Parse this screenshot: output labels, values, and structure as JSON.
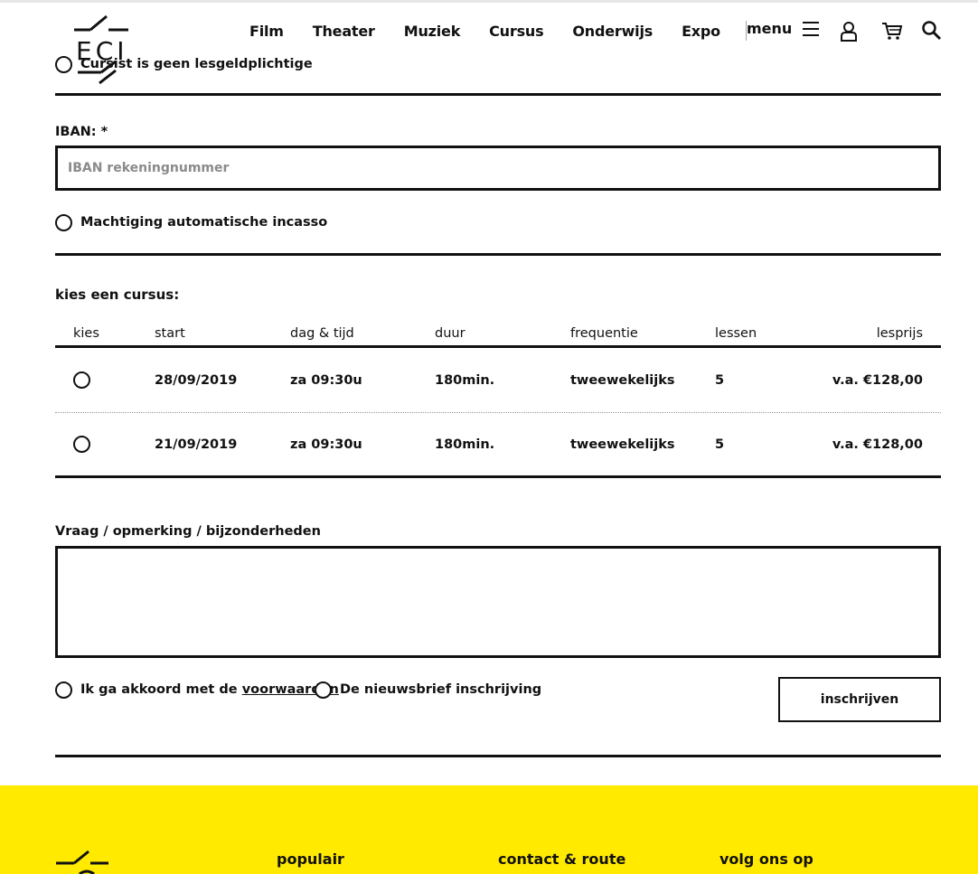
{
  "header": {
    "logo_text": "ECI",
    "nav": [
      "Film",
      "Theater",
      "Muziek",
      "Cursus",
      "Onderwijs",
      "Expo"
    ],
    "menu_label": "menu"
  },
  "form": {
    "cursist_label": "Cursist is geen lesgeldplichtige",
    "iban_label": "IBAN: *",
    "iban_placeholder": "IBAN rekeningnummer",
    "iban_value": "",
    "machtiging_label": "Machtiging automatische incasso",
    "choose_heading": "kies een cursus:",
    "table": {
      "headers": [
        "kies",
        "start",
        "dag & tijd",
        "duur",
        "frequentie",
        "lessen",
        "lesprijs"
      ],
      "rows": [
        {
          "start": "28/09/2019",
          "dag_tijd": "za 09:30u",
          "duur": "180min.",
          "frequentie": "tweewekelijks",
          "lessen": "5",
          "lesprijs": "v.a. €128,00"
        },
        {
          "start": "21/09/2019",
          "dag_tijd": "za 09:30u",
          "duur": "180min.",
          "frequentie": "tweewekelijks",
          "lessen": "5",
          "lesprijs": "v.a. €128,00"
        }
      ]
    },
    "remarks_label": "Vraag / opmerking / bijzonderheden",
    "remarks_value": "",
    "agree_prefix": "Ik ga akkoord met de",
    "agree_link": "voorwaarden",
    "newsletter_label": "De nieuwsbrief inschrijving",
    "submit_label": "inschrijven"
  },
  "footer": {
    "columns": [
      "populair",
      "contact & route",
      "volg ons op"
    ],
    "background_color": "#ffea00"
  },
  "icons": [
    "logo-icon",
    "hamburger-icon",
    "user-icon",
    "cart-icon",
    "search-icon",
    "footer-logo-icon"
  ]
}
